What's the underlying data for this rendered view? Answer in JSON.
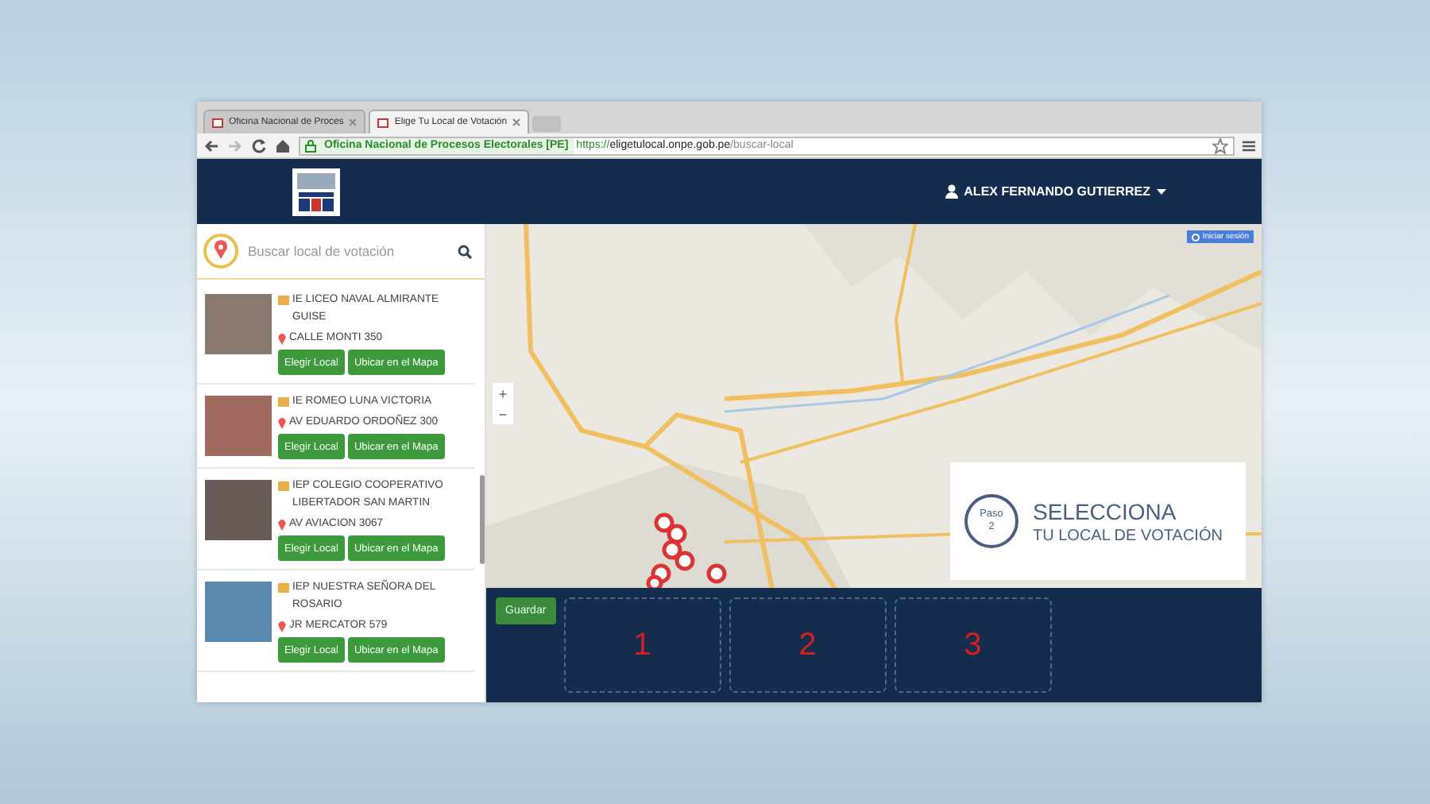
{
  "browser": {
    "tabs": [
      {
        "label": "Oficina Nacional de Proces",
        "selected": false
      },
      {
        "label": "Elige Tu Local de Votación",
        "selected": true
      }
    ],
    "security_label": "Oficina Nacional de Procesos Electorales [PE]",
    "url_scheme": "https://",
    "url_host": "eligetulocal.onpe.gob.pe",
    "url_path": "/buscar-local"
  },
  "header": {
    "user_name": "ALEX FERNANDO GUTIERREZ"
  },
  "search": {
    "placeholder": "Buscar local de votación"
  },
  "locales": [
    {
      "name": "IE LICEO NAVAL ALMIRANTE GUISE",
      "address": "CALLE MONTI 350",
      "buttons": [
        "Elegir Local",
        "Ubicar en el Mapa"
      ]
    },
    {
      "name": "IE ROMEO LUNA VICTORIA",
      "address": "AV EDUARDO ORDOÑEZ 300",
      "buttons": [
        "Elegir Local",
        "Ubicar en el Mapa"
      ]
    },
    {
      "name": "IEP COLEGIO COOPERATIVO LIBERTADOR SAN MARTIN",
      "address": "AV AVIACION 3067",
      "buttons": [
        "Elegir Local",
        "Ubicar en el Mapa"
      ]
    },
    {
      "name": "IEP NUESTRA SEÑORA DEL ROSARIO",
      "address": "JR MERCATOR 579",
      "buttons": [
        "Elegir Local",
        "Ubicar en el Mapa"
      ]
    }
  ],
  "map": {
    "signin_button": "Iniciar sesión",
    "zoom_in": "+",
    "zoom_out": "−"
  },
  "step": {
    "badge_word": "Paso",
    "badge_number": "2",
    "title": "SELECCIONA",
    "subtitle": "TU LOCAL DE VOTACIÓN"
  },
  "footer": {
    "save_button": "Guardar",
    "slots": [
      "1",
      "2",
      "3"
    ]
  }
}
